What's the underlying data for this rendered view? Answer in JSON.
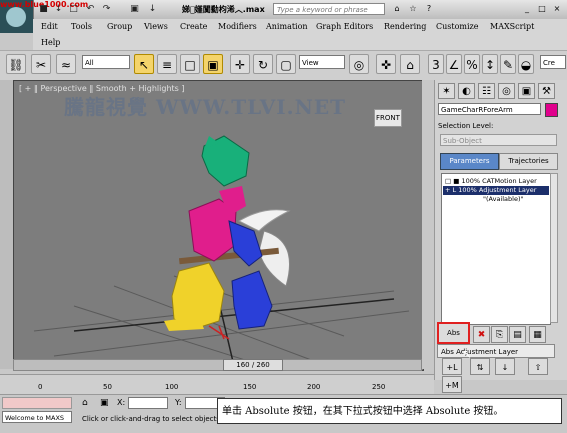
{
  "titlebar": {
    "watermark": "www.blue1000.com",
    "quick_access": [
      "■",
      "↓",
      "□",
      "↶",
      "↷",
      "▣",
      "↓"
    ],
    "document_title": "娣嫤闃勬枃浠︿.max",
    "search_placeholder": "Type a keyword or phrase",
    "buttons": [
      "⌂",
      "☆",
      "?",
      "_",
      "□",
      "×"
    ]
  },
  "menu": {
    "items": [
      "Edit",
      "Tools",
      "Group",
      "Views",
      "Create",
      "Modifiers",
      "Animation",
      "Graph Editors",
      "Rendering",
      "Customize",
      "MAXScript",
      "Help"
    ]
  },
  "toolbar": {
    "filter_value": "All",
    "refcoord_value": "View",
    "snap_label": "3",
    "named_sel": "Cre"
  },
  "viewport": {
    "label": "[ + ‖ Perspective ‖ Smooth + Highlights ]",
    "watermark": "騰龍視覺 WWW.TLVI.NET",
    "viewcube_label": "FRONT"
  },
  "command_panel": {
    "object_name": "GameCharRForeArm",
    "object_color": "#e0008c",
    "selection_level_label": "Selection Level:",
    "subobject_value": "Sub-Object",
    "tab_parameters": "Parameters",
    "tab_trajectories": "Trajectories",
    "layers": [
      {
        "label": "100% CATMotion Layer",
        "selected": false,
        "prefix": "□ ■"
      },
      {
        "label": "100% Adjustment Layer",
        "selected": true,
        "prefix": "+ L"
      },
      {
        "label": "\"(Available)\"",
        "selected": false,
        "prefix": ""
      }
    ],
    "abs_button": "Abs",
    "flyout_label": "Adjustment Layer",
    "flyout_prefix": "Abs"
  },
  "timeline": {
    "frame_display": "160 / 260",
    "ticks": [
      "0",
      "50",
      "100",
      "150",
      "200",
      "250"
    ]
  },
  "status": {
    "welcome": "Welcome to MAXS",
    "prompt": "Click or click-and-drag to select objects",
    "x_label": "X:",
    "y_label": "Y:"
  },
  "caption": {
    "text": "单击 Absolute 按钮，在其下拉式按钮中选择 Absolute 按钮。"
  }
}
